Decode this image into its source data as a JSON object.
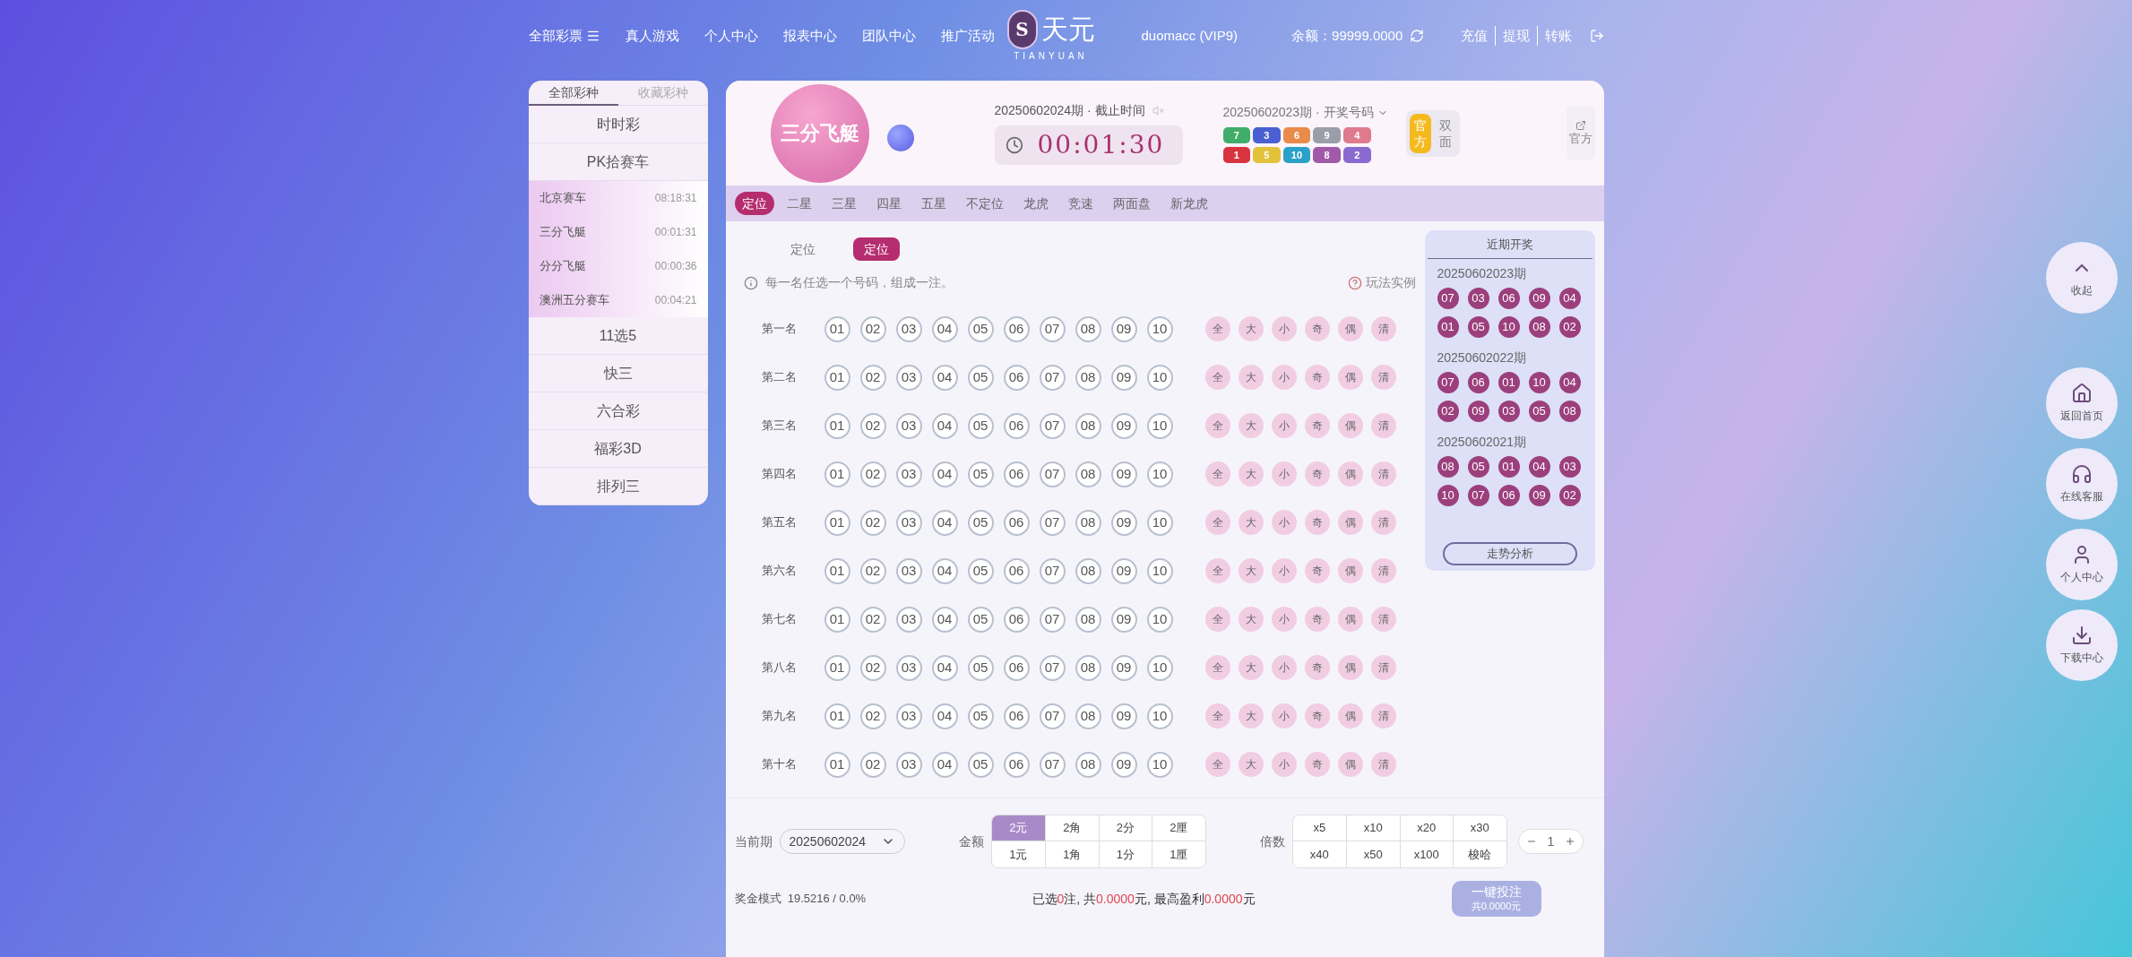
{
  "nav": {
    "left": [
      {
        "label": "全部彩票",
        "menu": true
      },
      {
        "label": "真人游戏",
        "menu": false
      },
      {
        "label": "个人中心",
        "menu": false
      },
      {
        "label": "报表中心",
        "menu": false
      },
      {
        "label": "团队中心",
        "menu": false
      },
      {
        "label": "推广活动",
        "menu": false
      }
    ],
    "logo": {
      "mark": "S",
      "name": "天元",
      "sub": "TIANYUAN"
    },
    "user": "duomacc (VIP9)",
    "balance": "余额：99999.0000",
    "links": [
      "充值",
      "提现",
      "转账"
    ]
  },
  "sidebar": {
    "tabs": [
      {
        "label": "全部彩种",
        "selected": true
      },
      {
        "label": "收藏彩种",
        "selected": false
      }
    ],
    "categories": [
      {
        "label": "时时彩"
      },
      {
        "label": "PK拾赛车",
        "children": [
          {
            "name": "北京赛车",
            "time": "08:18:31"
          },
          {
            "name": "三分飞艇",
            "time": "00:01:31"
          },
          {
            "name": "分分飞艇",
            "time": "00:00:36"
          },
          {
            "name": "澳洲五分赛车",
            "time": "00:04:21"
          }
        ]
      },
      {
        "label": "11选5"
      },
      {
        "label": "快三"
      },
      {
        "label": "六合彩"
      },
      {
        "label": "福彩3D"
      },
      {
        "label": "排列三"
      }
    ]
  },
  "header": {
    "game": "三分飞艇",
    "period": "20250602024期 · 截止时间",
    "countdown": "00:01:30",
    "last_period": "20250602023期 · 开奖号码",
    "cars": [
      {
        "number": "7",
        "color": "#3fae6a"
      },
      {
        "number": "3",
        "color": "#4a5fd1"
      },
      {
        "number": "6",
        "color": "#e98b4a"
      },
      {
        "number": "9",
        "color": "#9a9ea8"
      },
      {
        "number": "4",
        "color": "#e07a8e"
      },
      {
        "number": "1",
        "color": "#d8343f"
      },
      {
        "number": "5",
        "color": "#e2c23a"
      },
      {
        "number": "10",
        "color": "#2aa1c9"
      },
      {
        "number": "8",
        "color": "#a05aa8"
      },
      {
        "number": "2",
        "color": "#8a6ad0"
      }
    ],
    "modes": [
      {
        "label": "官方",
        "selected": true
      },
      {
        "label": "双面",
        "selected": false
      }
    ],
    "official_link": "官方"
  },
  "play_tabs": [
    {
      "label": "定位",
      "selected": true
    },
    {
      "label": "二星",
      "selected": false
    },
    {
      "label": "三星",
      "selected": false
    },
    {
      "label": "四星",
      "selected": false
    },
    {
      "label": "五星",
      "selected": false
    },
    {
      "label": "不定位",
      "selected": false
    },
    {
      "label": "龙虎",
      "selected": false
    },
    {
      "label": "竞速",
      "selected": false
    },
    {
      "label": "两面盘",
      "selected": false
    },
    {
      "label": "新龙虎",
      "selected": false
    }
  ],
  "sub_tabs": [
    {
      "label": "定位",
      "selected": false
    },
    {
      "label": "定位",
      "selected": true
    }
  ],
  "hint": "每一名任选一个号码，组成一注。",
  "example_link": "玩法实例",
  "rows": [
    {
      "label": "第一名",
      "numbers": [
        "01",
        "02",
        "03",
        "04",
        "05",
        "06",
        "07",
        "08",
        "09",
        "10"
      ],
      "quick": [
        "全",
        "大",
        "小",
        "奇",
        "偶",
        "清"
      ]
    },
    {
      "label": "第二名",
      "numbers": [
        "01",
        "02",
        "03",
        "04",
        "05",
        "06",
        "07",
        "08",
        "09",
        "10"
      ],
      "quick": [
        "全",
        "大",
        "小",
        "奇",
        "偶",
        "清"
      ]
    },
    {
      "label": "第三名",
      "numbers": [
        "01",
        "02",
        "03",
        "04",
        "05",
        "06",
        "07",
        "08",
        "09",
        "10"
      ],
      "quick": [
        "全",
        "大",
        "小",
        "奇",
        "偶",
        "清"
      ]
    },
    {
      "label": "第四名",
      "numbers": [
        "01",
        "02",
        "03",
        "04",
        "05",
        "06",
        "07",
        "08",
        "09",
        "10"
      ],
      "quick": [
        "全",
        "大",
        "小",
        "奇",
        "偶",
        "清"
      ]
    },
    {
      "label": "第五名",
      "numbers": [
        "01",
        "02",
        "03",
        "04",
        "05",
        "06",
        "07",
        "08",
        "09",
        "10"
      ],
      "quick": [
        "全",
        "大",
        "小",
        "奇",
        "偶",
        "清"
      ]
    },
    {
      "label": "第六名",
      "numbers": [
        "01",
        "02",
        "03",
        "04",
        "05",
        "06",
        "07",
        "08",
        "09",
        "10"
      ],
      "quick": [
        "全",
        "大",
        "小",
        "奇",
        "偶",
        "清"
      ]
    },
    {
      "label": "第七名",
      "numbers": [
        "01",
        "02",
        "03",
        "04",
        "05",
        "06",
        "07",
        "08",
        "09",
        "10"
      ],
      "quick": [
        "全",
        "大",
        "小",
        "奇",
        "偶",
        "清"
      ]
    },
    {
      "label": "第八名",
      "numbers": [
        "01",
        "02",
        "03",
        "04",
        "05",
        "06",
        "07",
        "08",
        "09",
        "10"
      ],
      "quick": [
        "全",
        "大",
        "小",
        "奇",
        "偶",
        "清"
      ]
    },
    {
      "label": "第九名",
      "numbers": [
        "01",
        "02",
        "03",
        "04",
        "05",
        "06",
        "07",
        "08",
        "09",
        "10"
      ],
      "quick": [
        "全",
        "大",
        "小",
        "奇",
        "偶",
        "清"
      ]
    },
    {
      "label": "第十名",
      "numbers": [
        "01",
        "02",
        "03",
        "04",
        "05",
        "06",
        "07",
        "08",
        "09",
        "10"
      ],
      "quick": [
        "全",
        "大",
        "小",
        "奇",
        "偶",
        "清"
      ]
    }
  ],
  "recent": {
    "title": "近期开奖",
    "draws": [
      {
        "period": "20250602023期",
        "numbers": [
          "07",
          "03",
          "06",
          "09",
          "04",
          "01",
          "05",
          "10",
          "08",
          "02"
        ]
      },
      {
        "period": "20250602022期",
        "numbers": [
          "07",
          "06",
          "01",
          "10",
          "04",
          "02",
          "09",
          "03",
          "05",
          "08"
        ]
      },
      {
        "period": "20250602021期",
        "numbers": [
          "08",
          "05",
          "01",
          "04",
          "03",
          "10",
          "07",
          "06",
          "09",
          "02"
        ]
      }
    ],
    "button": "走势分析"
  },
  "bottom": {
    "period_label": "当前期",
    "period_value": "20250602024",
    "amount_label": "金额",
    "amounts": [
      {
        "label": "2元",
        "selected": true
      },
      {
        "label": "2角",
        "selected": false
      },
      {
        "label": "2分",
        "selected": false
      },
      {
        "label": "2厘",
        "selected": false
      },
      {
        "label": "1元",
        "selected": false
      },
      {
        "label": "1角",
        "selected": false
      },
      {
        "label": "1分",
        "selected": false
      },
      {
        "label": "1厘",
        "selected": false
      }
    ],
    "multiplier_label": "倍数",
    "multipliers": [
      "x5",
      "x10",
      "x20",
      "x30",
      "x40",
      "x50",
      "x100",
      "梭哈"
    ],
    "quantity": "1",
    "bonus": "奖金模式  19.5216 / 0.0%",
    "summary": [
      {
        "text": "已选",
        "highlight": false
      },
      {
        "text": "0",
        "highlight": true
      },
      {
        "text": "注, 共",
        "highlight": false
      },
      {
        "text": "0.0000",
        "highlight": true
      },
      {
        "text": "元, 最高盈利",
        "highlight": false
      },
      {
        "text": "0.0000",
        "highlight": true
      },
      {
        "text": "元",
        "highlight": false
      }
    ],
    "bet_button": "一键投注",
    "bet_total": "共0.0000元"
  },
  "float_menu": [
    {
      "label": "收起"
    },
    {
      "label": "返回首页"
    },
    {
      "label": "在线客服"
    },
    {
      "label": "个人中心"
    },
    {
      "label": "下载中心"
    }
  ]
}
